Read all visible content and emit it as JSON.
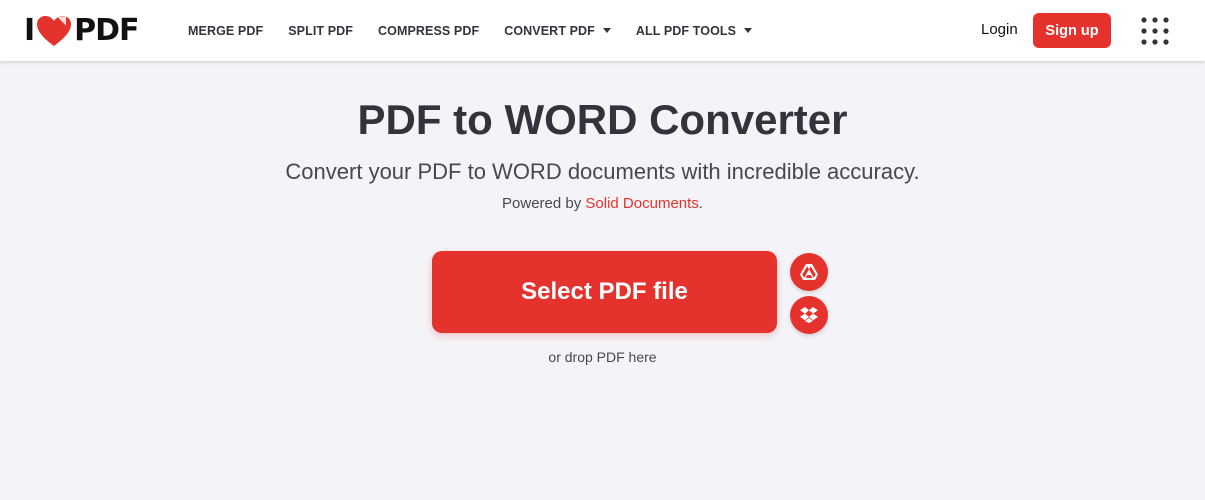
{
  "header": {
    "logo": {
      "left": "I",
      "right": "PDF"
    },
    "nav": [
      {
        "label": "MERGE PDF",
        "dropdown": false
      },
      {
        "label": "SPLIT PDF",
        "dropdown": false
      },
      {
        "label": "COMPRESS PDF",
        "dropdown": false
      },
      {
        "label": "CONVERT PDF",
        "dropdown": true
      },
      {
        "label": "ALL PDF TOOLS",
        "dropdown": true
      }
    ],
    "login_label": "Login",
    "signup_label": "Sign up"
  },
  "main": {
    "title": "PDF to WORD Converter",
    "subtitle": "Convert your PDF to WORD documents with incredible accuracy.",
    "powered_prefix": "Powered by ",
    "powered_link": "Solid Documents",
    "powered_suffix": ".",
    "select_label": "Select PDF file",
    "drop_hint": "or drop PDF here"
  },
  "icons": {
    "logo": "heart-icon",
    "apps": "apps-grid-icon",
    "cloud_1": "google-drive-icon",
    "cloud_2": "dropbox-icon"
  },
  "colors": {
    "accent": "#e5322d",
    "background": "#f4f4f8",
    "header": "#ffffff",
    "text": "#33333b"
  }
}
